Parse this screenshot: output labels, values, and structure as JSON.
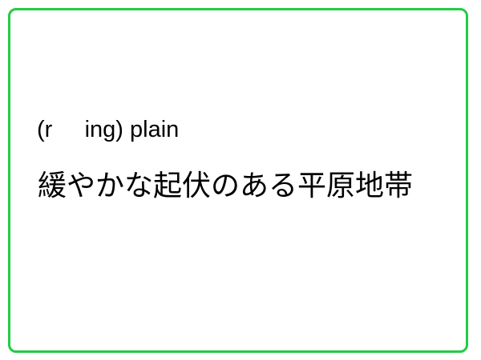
{
  "card": {
    "border_color": "#22cc44",
    "term": "(r     ing) plain",
    "meaning": "緩やかな起伏のある平原地帯"
  }
}
